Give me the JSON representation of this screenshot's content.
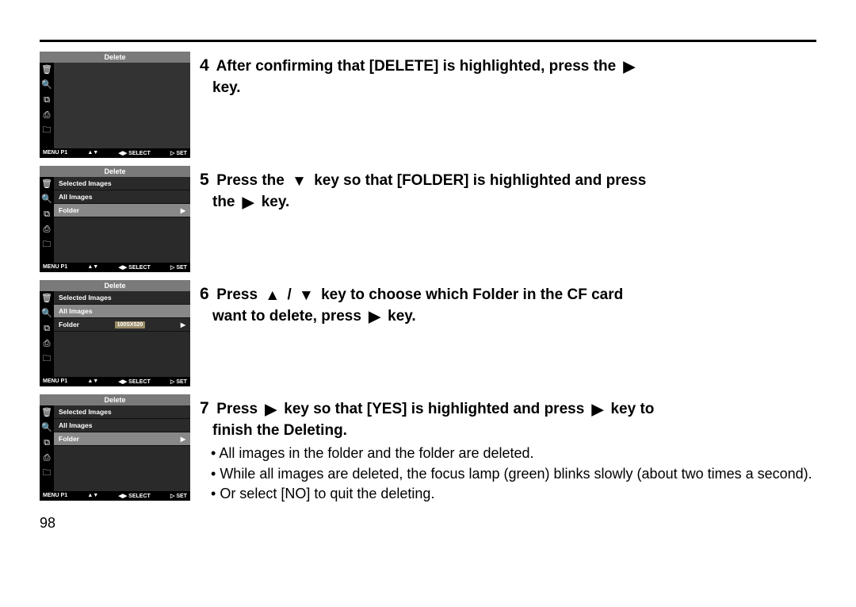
{
  "page_number": "98",
  "triangles": {
    "right": "▶",
    "down": "▼",
    "up": "▲"
  },
  "lcd_common": {
    "title": "Delete",
    "menu_items": [
      "Selected Images",
      "All Images",
      "Folder"
    ],
    "folder_badge": "100SX520",
    "status_left": "MENU P1",
    "status_mid_a": "▲▼",
    "status_mid_b": "◀▶  SELECT",
    "status_right": "▷ SET",
    "icons": [
      "🗑",
      "🔍",
      "⧉",
      "⎙",
      "🗀"
    ]
  },
  "steps": [
    {
      "num": "4",
      "text": [
        "After confirming that [DELETE] is highlighted, press the",
        "key."
      ],
      "show_items": false,
      "folder_hi": false,
      "badge": false
    },
    {
      "num": "5",
      "text": [
        "Press the",
        "key so that [FOLDER] is highlighted and press",
        "the",
        "key."
      ],
      "show_items": true,
      "folder_hi": true,
      "badge": false
    },
    {
      "num": "6",
      "text": [
        "Press",
        "/",
        "key to choose which Folder in the CF card",
        "want to delete, press",
        "key."
      ],
      "show_items": true,
      "folder_hi": false,
      "badge": true
    },
    {
      "num": "7",
      "text": [
        "Press",
        "key so that [YES] is highlighted and press",
        "key to",
        "finish the Deleting."
      ],
      "show_items": true,
      "folder_hi": true,
      "badge": false,
      "bullets": [
        "All images in the folder and the folder are deleted.",
        "While all images are deleted, the focus lamp (green) blinks slowly (about two times a second).",
        "Or select [NO] to quit the deleting."
      ]
    }
  ]
}
